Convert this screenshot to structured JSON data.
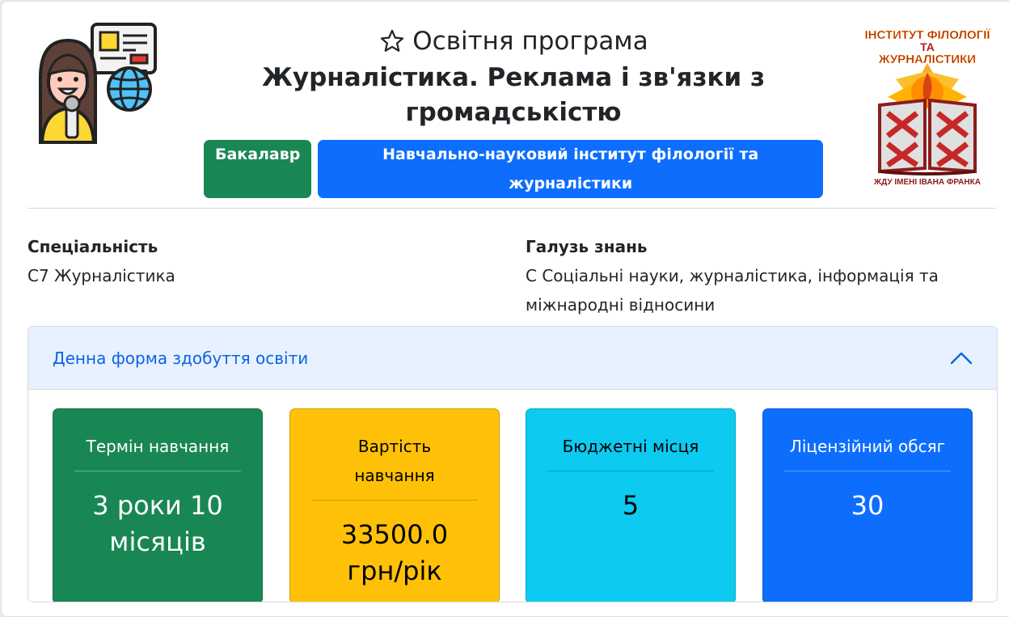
{
  "header": {
    "program_prefix": "Освітня програма",
    "program_title": "Журналістика. Реклама і зв'язки з громадськістю",
    "degree_badge": "Бакалавр",
    "institute_badge": "Навчально-науковий інститут філології та журналістики",
    "illustration_icon": "journalist-icon",
    "favorite_icon": "star-outline-icon"
  },
  "logo": {
    "line1": "ІНСТИТУТ ФІЛОЛОГІЇ",
    "line2": "ТА",
    "line3": "ЖУРНАЛІСТИКИ",
    "bottom": "ЖДУ ІМЕНІ ІВАНА ФРАНКА"
  },
  "specialty": {
    "label": "Спеціальність",
    "value": "С7 Журналістика"
  },
  "field_of_knowledge": {
    "label": "Галузь знань",
    "value_line1": "C Соціальні науки, журналістика, інформація та",
    "value_line2": "міжнародні відносини"
  },
  "accordion": {
    "title": "Денна форма здобуття освіти",
    "expanded": true,
    "toggle_icon": "chevron-up-icon",
    "tiles": [
      {
        "title": "Термін навчання",
        "value_line1": "3 роки 10",
        "value_line2": "місяців",
        "color": "#198754"
      },
      {
        "title_line1": "Вартість",
        "title_line2": "навчання",
        "value_line1": "33500.0",
        "value_line2": "грн/рік",
        "color": "#ffc107"
      },
      {
        "title": "Бюджетні місця",
        "value": "5",
        "color": "#0dcaf0"
      },
      {
        "title": "Ліцензійний обсяг",
        "value": "30",
        "color": "#0d6efd"
      }
    ]
  }
}
